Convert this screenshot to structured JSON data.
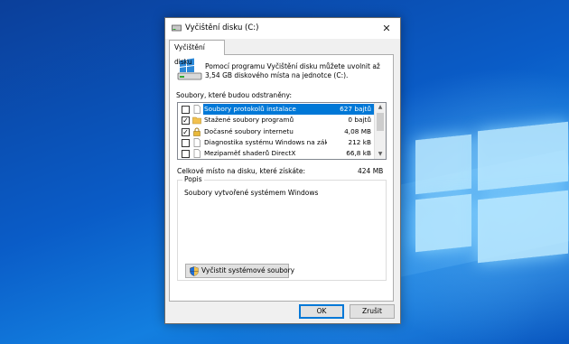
{
  "window": {
    "title": "Vyčištění disku  (C:)",
    "close_glyph": "✕"
  },
  "tab": {
    "label": "Vyčištění disku"
  },
  "intro": {
    "text": "Pomocí programu Vyčištění disku můžete uvolnit až 3,54 GB diskového místa na jednotce  (C:)."
  },
  "files_list": {
    "label": "Soubory, které budou odstraněny:",
    "items": [
      {
        "name": "Soubory protokolů instalace",
        "size": "627 bajtů",
        "checked": false,
        "selected": true,
        "icon": "blank-file-icon"
      },
      {
        "name": "Stažené soubory programů",
        "size": "0 bajtů",
        "checked": true,
        "selected": false,
        "icon": "folder-icon"
      },
      {
        "name": "Dočasné soubory internetu",
        "size": "4,08 MB",
        "checked": true,
        "selected": false,
        "icon": "lock-icon"
      },
      {
        "name": "Diagnostika systému Windows na zákl...",
        "size": "212 kB",
        "checked": false,
        "selected": false,
        "icon": "blank-file-icon"
      },
      {
        "name": "Mezipaměť shaderů DirectX",
        "size": "66,8 kB",
        "checked": false,
        "selected": false,
        "icon": "blank-file-icon"
      },
      {
        "name": "",
        "size": "",
        "checked": false,
        "selected": false,
        "icon": "blank-file-icon"
      }
    ]
  },
  "total": {
    "label": "Celkové místo na disku, které získáte:",
    "value": "424 MB"
  },
  "description": {
    "legend": "Popis",
    "text": "Soubory vytvořené systémem Windows"
  },
  "buttons": {
    "clean_system": "Vyčistit systémové soubory",
    "ok": "OK",
    "cancel": "Zrušit"
  },
  "colors": {
    "selection": "#0078d7",
    "desktop": "#0a5fc4"
  }
}
